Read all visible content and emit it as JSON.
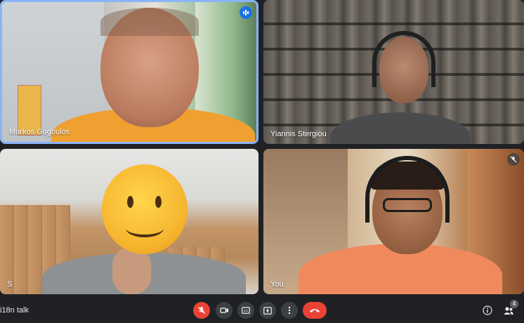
{
  "participants": [
    {
      "name": "Markos Gogoulos",
      "speaking": true,
      "muted": false
    },
    {
      "name": "Yiannis Stergiou",
      "speaking": false,
      "muted": false
    },
    {
      "name": "S",
      "speaking": false,
      "muted": false
    },
    {
      "name": "You",
      "speaking": false,
      "muted": true
    }
  ],
  "meeting": {
    "name": "i18n talk"
  },
  "controls": {
    "participant_count": "4",
    "icons": [
      "mic-off-icon",
      "camera-icon",
      "captions-icon",
      "present-icon",
      "more-icon",
      "end-call-icon",
      "info-icon",
      "people-icon"
    ]
  },
  "colors": {
    "speaking_border": "#8ab4f8",
    "speaking_badge": "#1a73e8",
    "danger": "#ea4335",
    "bar_bg": "#202124",
    "button_bg": "#3c4043"
  }
}
